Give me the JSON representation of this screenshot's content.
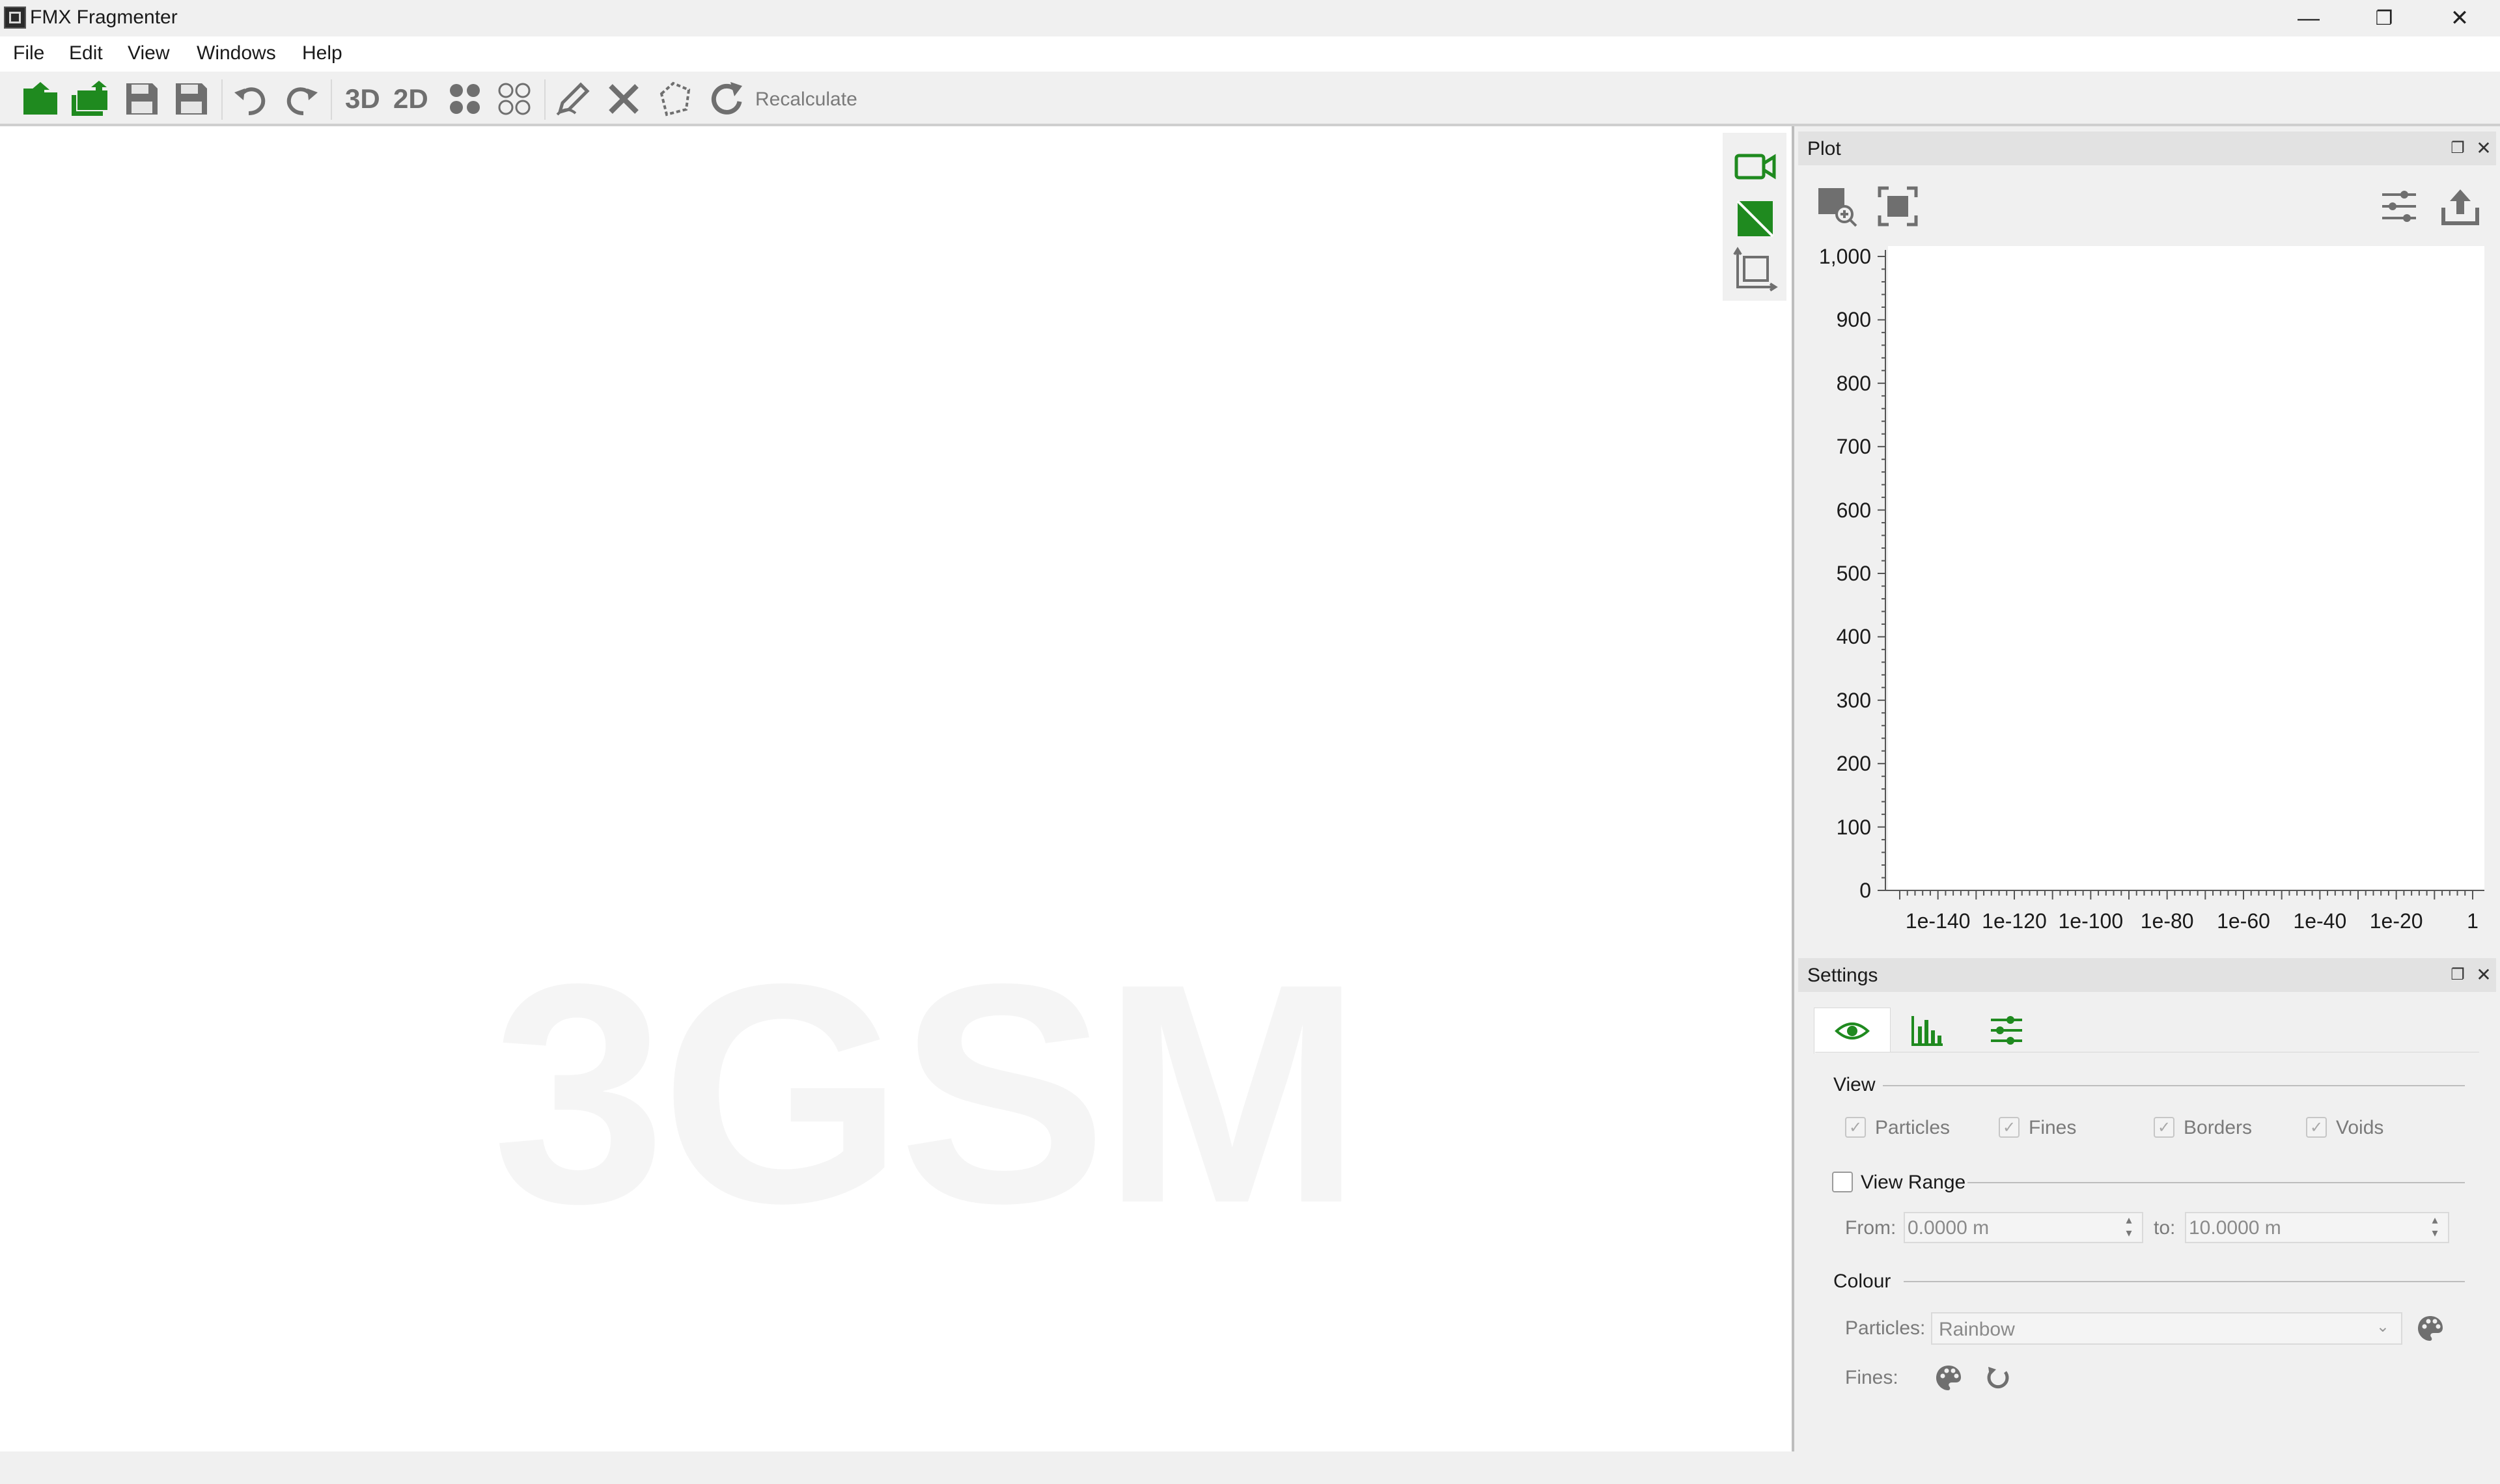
{
  "window": {
    "title": "FMX Fragmenter",
    "controls": {
      "minimize": "—",
      "restore": "❐",
      "close": "✕"
    }
  },
  "menu": [
    "File",
    "Edit",
    "View",
    "Windows",
    "Help"
  ],
  "toolbar": {
    "icons": [
      "open-file-icon",
      "open-multiple-icon",
      "save-icon",
      "save-as-icon",
      "undo-icon",
      "redo-icon",
      "view-3d",
      "view-2d",
      "particles-icon",
      "particles-outline-icon",
      "edit-pen-icon",
      "delete-icon",
      "lasso-icon",
      "recalculate-icon"
    ],
    "view_3d_label": "3D",
    "view_2d_label": "2D",
    "recalculate_label": "Recalculate"
  },
  "viewport": {
    "watermark": "3GSM",
    "tools": [
      "camera-icon",
      "surface-toggle-icon",
      "crop-icon"
    ]
  },
  "plot_panel": {
    "title": "Plot",
    "float_glyph": "❐",
    "close_glyph": "✕",
    "tools": [
      "zoom-region-icon",
      "fit-view-icon",
      "plot-settings-icon",
      "export-icon"
    ]
  },
  "chart_data": {
    "type": "line",
    "title": "",
    "xlabel": "",
    "ylabel": "",
    "x_scale": "log",
    "xlim": [
      1e-150,
      1
    ],
    "ylim": [
      0,
      1000
    ],
    "x_ticks": [
      "1e-140",
      "1e-120",
      "1e-100",
      "1e-80",
      "1e-60",
      "1e-40",
      "1e-20",
      "1"
    ],
    "y_ticks": [
      "0",
      "100",
      "200",
      "300",
      "400",
      "500",
      "600",
      "700",
      "800",
      "900",
      "1,000"
    ],
    "series": [],
    "grid": false
  },
  "settings_panel": {
    "title": "Settings",
    "float_glyph": "❐",
    "close_glyph": "✕",
    "tabs": [
      "view-tab-eye-icon",
      "histogram-tab-icon",
      "sliders-tab-icon"
    ],
    "view_group": {
      "title": "View",
      "checkboxes": [
        {
          "label": "Particles",
          "checked": true
        },
        {
          "label": "Fines",
          "checked": true
        },
        {
          "label": "Borders",
          "checked": true
        },
        {
          "label": "Voids",
          "checked": true
        }
      ]
    },
    "view_range": {
      "label": "View Range",
      "checked": false,
      "from_label": "From:",
      "from_value": "0.0000 m",
      "to_label": "to:",
      "to_value": "10.0000 m"
    },
    "colour_group": {
      "title": "Colour",
      "particles_label": "Particles:",
      "particles_value": "Rainbow",
      "fines_label": "Fines:"
    }
  },
  "colors": {
    "accent_green": "#1f8a1f",
    "icon_gray": "#6f6f6f",
    "panel_bg": "#f0f0f0"
  }
}
